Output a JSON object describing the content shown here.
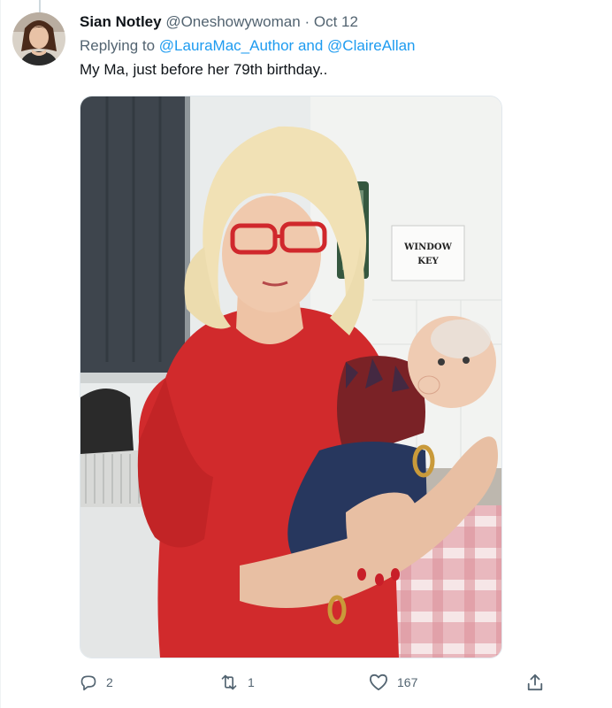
{
  "tweet": {
    "author_name": "Sian Notley",
    "author_handle": "@Oneshowywoman",
    "separator": "·",
    "date": "Oct 12",
    "replying_prefix": "Replying to",
    "mention_1": "@LauraMac_Author",
    "mention_joiner": "and",
    "mention_2": "@ClaireAllan",
    "text": "My Ma, just before her 79th birthday.."
  },
  "media": {
    "sign_line_1": "WINDOW",
    "sign_line_2": "KEY"
  },
  "actions": {
    "reply_icon": "reply-icon",
    "reply_count": "2",
    "retweet_icon": "retweet-icon",
    "retweet_count": "1",
    "like_icon": "heart-icon",
    "like_count": "167",
    "share_icon": "share-icon"
  },
  "colors": {
    "link": "#1d9bf0",
    "secondary_text": "#536471",
    "primary_text": "#0f1419"
  }
}
